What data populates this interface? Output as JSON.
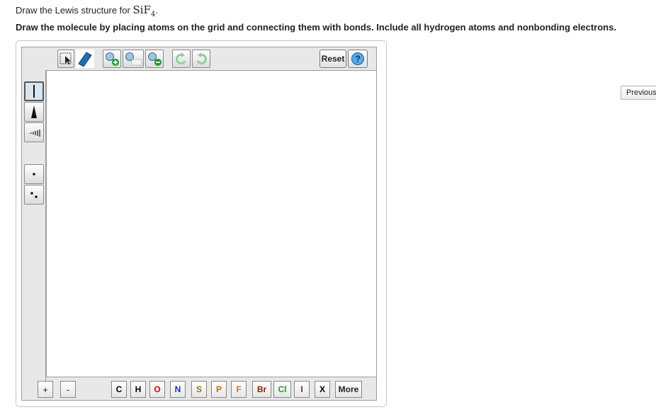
{
  "question": {
    "prefix": "Draw the Lewis structure for ",
    "formula_main": "SiF",
    "formula_sub": "4",
    "suffix": ".",
    "instructions": "Draw the molecule by placing atoms on the grid and connecting them with bonds. Include all hydrogen atoms and nonbonding electrons."
  },
  "toolbar": {
    "reset_label": "Reset",
    "help_label": "?",
    "icons": [
      "selection-icon",
      "eraser-icon",
      "add-charge-icon",
      "atom-map-icon",
      "remove-charge-icon",
      "undo-icon",
      "redo-icon"
    ]
  },
  "side_tools": [
    "single-bond",
    "wedge-bond",
    "hash-bond",
    "lone-electron",
    "electron-pair"
  ],
  "bottom": {
    "plus": "+",
    "minus": "-",
    "elements": [
      {
        "symbol": "C",
        "color": "#000000"
      },
      {
        "symbol": "H",
        "color": "#000000"
      },
      {
        "symbol": "O",
        "color": "#e10000"
      },
      {
        "symbol": "N",
        "color": "#1c2fd6"
      },
      {
        "symbol": "S",
        "color": "#8a7a14"
      },
      {
        "symbol": "P",
        "color": "#c76a00"
      },
      {
        "symbol": "F",
        "color": "#c77b1c"
      },
      {
        "symbol": "Br",
        "color": "#8b2500"
      },
      {
        "symbol": "Cl",
        "color": "#1f9d1f"
      },
      {
        "symbol": "I",
        "color": "#6a1c8c"
      },
      {
        "symbol": "X",
        "color": "#000000"
      }
    ],
    "more_label": "More"
  },
  "nav": {
    "previous_label": "Previous"
  }
}
